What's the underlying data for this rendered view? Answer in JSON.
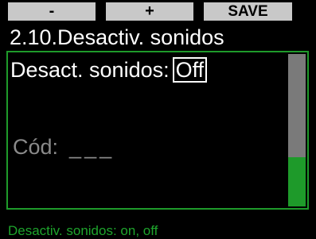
{
  "softkeys": {
    "minus": "-",
    "plus": "+",
    "save": "SAVE"
  },
  "title": "2.10.Desactiv. sonidos",
  "settings": {
    "sounds_label": "Desact. sonidos:",
    "sounds_value": "Off",
    "code_label": "Cód:",
    "code_value": "___"
  },
  "footer": "Desactiv. sonidos: on, off",
  "colors": {
    "accent": "#1e9a2a",
    "footer_text": "#1ea42c",
    "softkey_bg": "#c8c8c8",
    "inactive_text": "#8a8a8a",
    "scrollbar_track": "#7a7a7a"
  }
}
